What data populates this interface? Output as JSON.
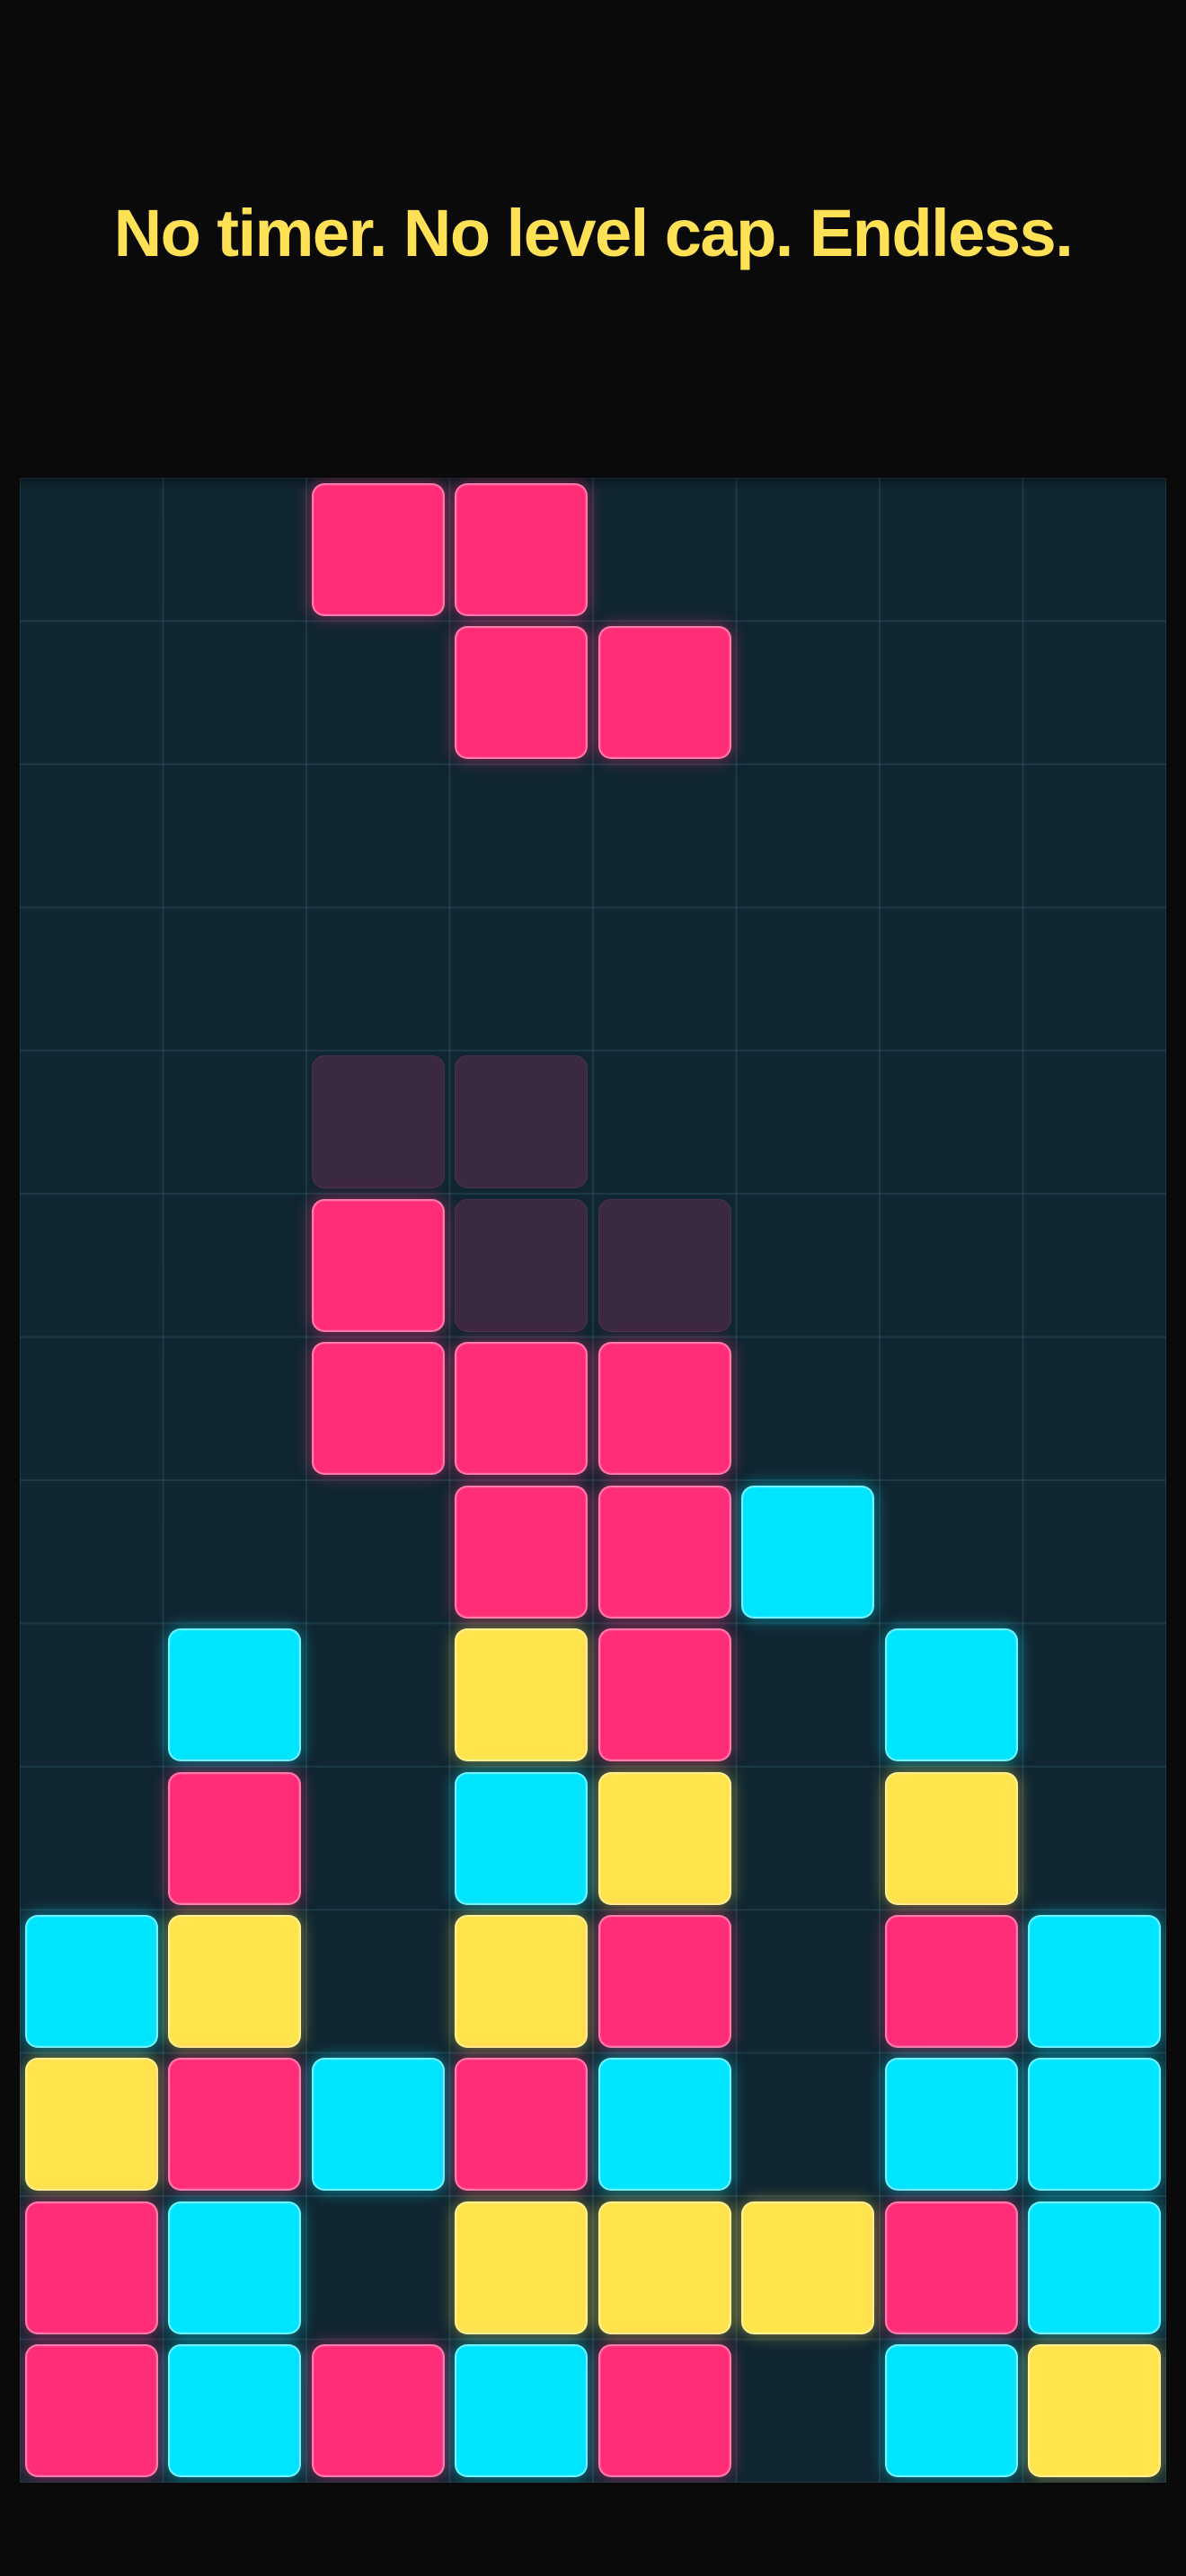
{
  "header": {
    "tagline": "No timer. No level cap. Endless."
  },
  "board": {
    "columns": 8,
    "rows": 14,
    "colors": {
      "pink": "#ff2d78",
      "cyan": "#00e5ff",
      "yellow": "#ffe44e",
      "ghost": "#3a2941",
      "background": "#102631"
    },
    "falling_piece": {
      "shape": "Z",
      "color": "pink",
      "cells": [
        [
          0,
          2
        ],
        [
          0,
          3
        ],
        [
          1,
          3
        ],
        [
          1,
          4
        ]
      ]
    },
    "ghost_piece": {
      "cells": [
        [
          4,
          2
        ],
        [
          4,
          3
        ],
        [
          5,
          3
        ],
        [
          5,
          4
        ]
      ]
    },
    "locked_cells": [
      {
        "row": 5,
        "col": 2,
        "color": "pink"
      },
      {
        "row": 6,
        "col": 2,
        "color": "pink"
      },
      {
        "row": 6,
        "col": 3,
        "color": "pink"
      },
      {
        "row": 6,
        "col": 4,
        "color": "pink"
      },
      {
        "row": 7,
        "col": 3,
        "color": "pink"
      },
      {
        "row": 7,
        "col": 4,
        "color": "pink"
      },
      {
        "row": 7,
        "col": 5,
        "color": "cyan"
      },
      {
        "row": 8,
        "col": 1,
        "color": "cyan"
      },
      {
        "row": 8,
        "col": 3,
        "color": "yellow"
      },
      {
        "row": 8,
        "col": 4,
        "color": "pink"
      },
      {
        "row": 8,
        "col": 6,
        "color": "cyan"
      },
      {
        "row": 9,
        "col": 1,
        "color": "pink"
      },
      {
        "row": 9,
        "col": 3,
        "color": "cyan"
      },
      {
        "row": 9,
        "col": 4,
        "color": "yellow"
      },
      {
        "row": 9,
        "col": 6,
        "color": "yellow"
      },
      {
        "row": 10,
        "col": 0,
        "color": "cyan"
      },
      {
        "row": 10,
        "col": 1,
        "color": "yellow"
      },
      {
        "row": 10,
        "col": 3,
        "color": "yellow"
      },
      {
        "row": 10,
        "col": 4,
        "color": "pink"
      },
      {
        "row": 10,
        "col": 6,
        "color": "pink"
      },
      {
        "row": 10,
        "col": 7,
        "color": "cyan"
      },
      {
        "row": 11,
        "col": 0,
        "color": "yellow"
      },
      {
        "row": 11,
        "col": 1,
        "color": "pink"
      },
      {
        "row": 11,
        "col": 2,
        "color": "cyan"
      },
      {
        "row": 11,
        "col": 3,
        "color": "pink"
      },
      {
        "row": 11,
        "col": 4,
        "color": "cyan"
      },
      {
        "row": 11,
        "col": 6,
        "color": "cyan"
      },
      {
        "row": 11,
        "col": 7,
        "color": "cyan"
      },
      {
        "row": 12,
        "col": 0,
        "color": "pink"
      },
      {
        "row": 12,
        "col": 1,
        "color": "cyan"
      },
      {
        "row": 12,
        "col": 3,
        "color": "yellow"
      },
      {
        "row": 12,
        "col": 4,
        "color": "yellow"
      },
      {
        "row": 12,
        "col": 5,
        "color": "yellow"
      },
      {
        "row": 12,
        "col": 6,
        "color": "pink"
      },
      {
        "row": 12,
        "col": 7,
        "color": "cyan"
      },
      {
        "row": 13,
        "col": 0,
        "color": "pink"
      },
      {
        "row": 13,
        "col": 1,
        "color": "cyan"
      },
      {
        "row": 13,
        "col": 2,
        "color": "pink"
      },
      {
        "row": 13,
        "col": 3,
        "color": "cyan"
      },
      {
        "row": 13,
        "col": 4,
        "color": "pink"
      },
      {
        "row": 13,
        "col": 6,
        "color": "cyan"
      },
      {
        "row": 13,
        "col": 7,
        "color": "yellow"
      }
    ]
  }
}
